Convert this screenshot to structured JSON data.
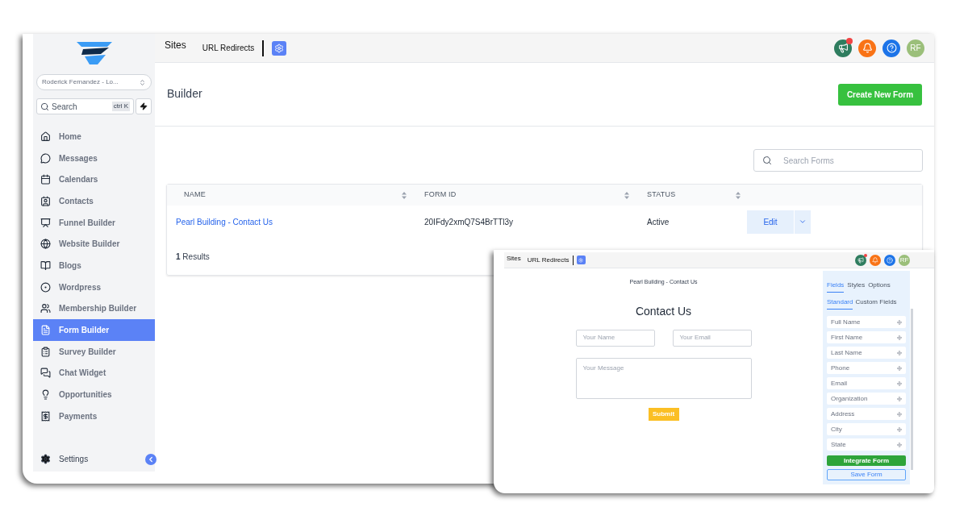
{
  "sidebar": {
    "account": "Roderick Fernandez - Lo...",
    "search": {
      "placeholder": "Search",
      "shortcut": "ctrl K"
    },
    "items": [
      {
        "label": "Home",
        "selected": false
      },
      {
        "label": "Messages",
        "selected": false
      },
      {
        "label": "Calendars",
        "selected": false
      },
      {
        "label": "Contacts",
        "selected": false
      },
      {
        "label": "Funnel Builder",
        "selected": false
      },
      {
        "label": "Website Builder",
        "selected": false
      },
      {
        "label": "Blogs",
        "selected": false
      },
      {
        "label": "Wordpress",
        "selected": false
      },
      {
        "label": "Membership Builder",
        "selected": false
      },
      {
        "label": "Form Builder",
        "selected": true
      },
      {
        "label": "Survey Builder",
        "selected": false
      },
      {
        "label": "Chat Widget",
        "selected": false
      },
      {
        "label": "Opportunities",
        "selected": false
      },
      {
        "label": "Payments",
        "selected": false
      }
    ],
    "settings": "Settings"
  },
  "topbar": {
    "title": "Sites",
    "link": "URL Redirects",
    "avatar": "RF"
  },
  "header": {
    "title": "Builder",
    "create_button": "Create New Form"
  },
  "search": {
    "placeholder": "Search Forms"
  },
  "table": {
    "columns": [
      "NAME",
      "FORM ID",
      "STATUS"
    ],
    "rows": [
      {
        "name": "Pearl Building - Contact Us",
        "form_id": "20IFdy2xmQ7S4BrTTl3y",
        "status": "Active",
        "action": "Edit"
      }
    ],
    "results_count": "1",
    "results_label": "Results"
  },
  "preview": {
    "topbar": {
      "title": "Sites",
      "link": "URL Redirects",
      "avatar": "RF"
    },
    "form_name": "Pearl Building - Contact Us",
    "heading": "Contact Us",
    "inputs": [
      {
        "placeholder": "Your Name"
      },
      {
        "placeholder": "Your Email"
      }
    ],
    "message_placeholder": "Your Message",
    "submit": "Submit",
    "panel": {
      "tabs": [
        {
          "label": "Fields",
          "selected": true
        },
        {
          "label": "Styles",
          "selected": false
        },
        {
          "label": "Options",
          "selected": false
        }
      ],
      "subtabs": [
        {
          "label": "Standard",
          "selected": true
        },
        {
          "label": "Custom Fields",
          "selected": false
        }
      ],
      "fields": [
        "Full Name",
        "First Name",
        "Last Name",
        "Phone",
        "Email",
        "Organization",
        "Address",
        "City",
        "State"
      ],
      "integrate_button": "Integrate Form",
      "save_button": "Save Form"
    }
  }
}
